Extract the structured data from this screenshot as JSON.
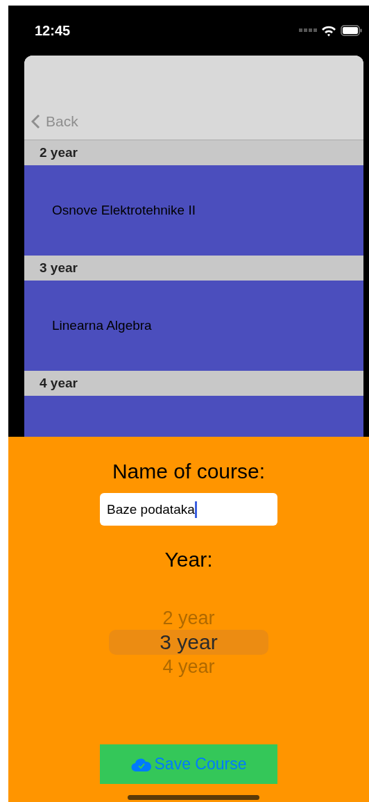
{
  "status_bar": {
    "time": "12:45"
  },
  "nav": {
    "back": "Back"
  },
  "sections": [
    {
      "header": "2 year",
      "course": "Osnove Elektrotehnike II"
    },
    {
      "header": "3 year",
      "course": "Linearna Algebra"
    },
    {
      "header": "4 year"
    }
  ],
  "form": {
    "name_label": "Name of course:",
    "name_value": "Baze podataka",
    "year_label": "Year:",
    "picker": [
      {
        "label": "2 year",
        "selected": false
      },
      {
        "label": "3 year",
        "selected": true
      },
      {
        "label": "4 year",
        "selected": false
      }
    ],
    "save_button": "Save Course"
  }
}
